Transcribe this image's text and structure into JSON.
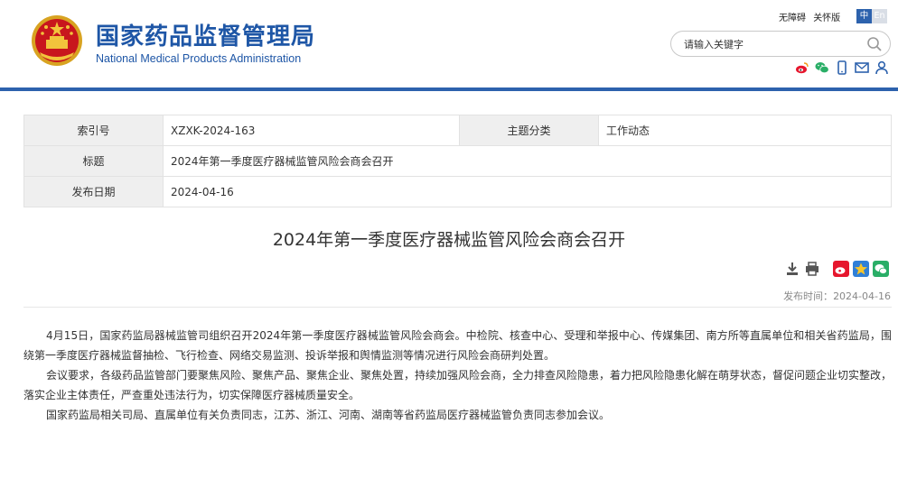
{
  "header": {
    "site_name_cn": "国家药品监督管理局",
    "site_name_en": "National Medical Products Administration",
    "top_links": [
      "无障碍",
      "关怀版"
    ],
    "lang_active": "中",
    "lang_other": "En",
    "search_placeholder": "请输入关键字",
    "social_icons": [
      "weibo-icon",
      "wechat-icon",
      "mobile-icon",
      "mail-icon",
      "user-icon"
    ]
  },
  "meta": {
    "index_label": "索引号",
    "index_value": "XZXK-2024-163",
    "category_label": "主题分类",
    "category_value": "工作动态",
    "title_label": "标题",
    "title_value": "2024年第一季度医疗器械监管风险会商会召开",
    "date_label": "发布日期",
    "date_value": "2024-04-16"
  },
  "article": {
    "title": "2024年第一季度医疗器械监管风险会商会召开",
    "pub_label": "发布时间：",
    "pub_date": "2024-04-16",
    "paragraphs": [
      "4月15日，国家药监局器械监管司组织召开2024年第一季度医疗器械监管风险会商会。中检院、核查中心、受理和举报中心、传媒集团、南方所等直属单位和相关省药监局，围绕第一季度医疗器械监督抽检、飞行检查、网络交易监测、投诉举报和舆情监测等情况进行风险会商研判处置。",
      "会议要求，各级药品监管部门要聚焦风险、聚焦产品、聚焦企业、聚焦处置，持续加强风险会商，全力排查风险隐患，着力把风险隐患化解在萌芽状态，督促问题企业切实整改，落实企业主体责任，严查重处违法行为，切实保障医疗器械质量安全。",
      "国家药监局相关司局、直属单位有关负责同志，江苏、浙江、河南、湖南等省药监局医疗器械监管负责同志参加会议。"
    ]
  },
  "colors": {
    "brand_blue": "#1e56a6",
    "header_rule": "#2d62ad",
    "weibo_red": "#e6162d",
    "wechat_green": "#2aae67"
  }
}
